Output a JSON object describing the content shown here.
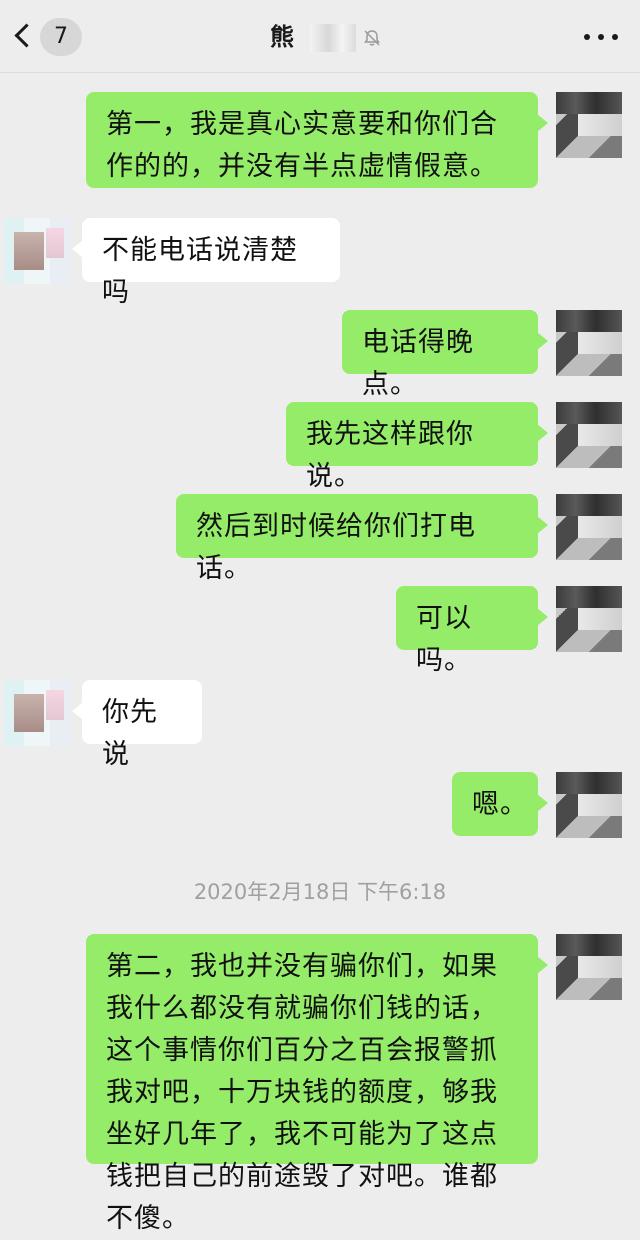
{
  "header": {
    "back_badge": "7",
    "title": "熊"
  },
  "messages": [
    {
      "from": "me",
      "text": "第一，我是真心实意要和你们合作的的，并没有半点虚情假意。"
    },
    {
      "from": "them",
      "text": "不能电话说清楚吗"
    },
    {
      "from": "me",
      "text": "电话得晚点。"
    },
    {
      "from": "me",
      "text": "我先这样跟你说。"
    },
    {
      "from": "me",
      "text": "然后到时候给你们打电话。"
    },
    {
      "from": "me",
      "text": "可以吗。"
    },
    {
      "from": "them",
      "text": "你先说"
    },
    {
      "from": "me",
      "text": "嗯。"
    },
    {
      "from": "me",
      "text": "第二，我也并没有骗你们，如果我什么都没有就骗你们钱的话，这个事情你们百分之百会报警抓我对吧，十万块钱的额度，够我坐好几年了，我不可能为了这点钱把自己的前途毁了对吧。谁都不傻。"
    }
  ],
  "timestamp": "2020年2月18日 下午6:18",
  "colors": {
    "background": "#ededed",
    "my_bubble": "#95ec69",
    "their_bubble": "#ffffff"
  }
}
